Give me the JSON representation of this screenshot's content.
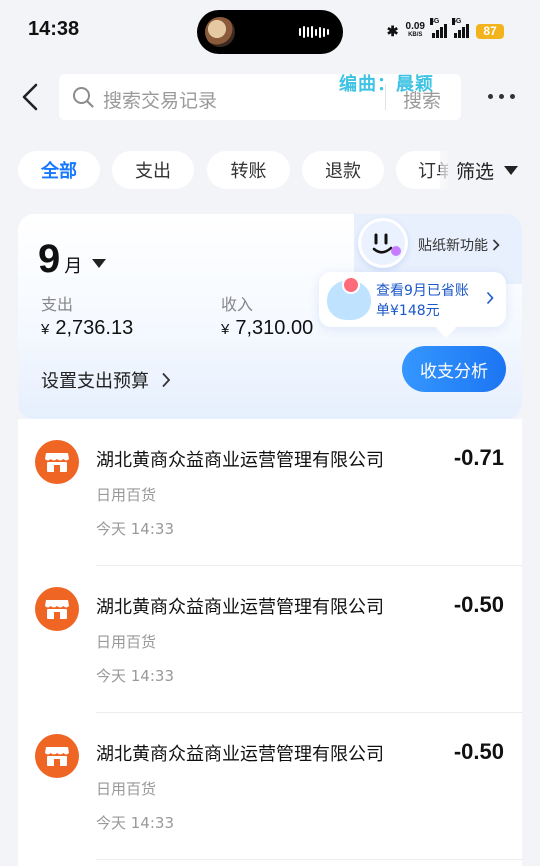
{
  "status_bar": {
    "time": "14:38",
    "net_speed": "0.09",
    "net_unit": "KB/S",
    "net_type_1": "4G",
    "net_type_2": "5G",
    "battery": "87"
  },
  "search": {
    "placeholder": "搜索交易记录",
    "button_label": "搜索",
    "icon": "search-icon"
  },
  "watermark": "编曲：晨颖",
  "filters": {
    "chips": [
      "全部",
      "支出",
      "转账",
      "退款",
      "订单"
    ],
    "active": "全部",
    "filter_label": "筛选"
  },
  "summary": {
    "sticker_link": "贴纸新功能",
    "month_num": "9",
    "month_unit": "月",
    "expense_label": "支出",
    "expense_currency": "¥",
    "expense_value": "2,736.13",
    "income_label": "收入",
    "income_currency": "¥",
    "income_value": "7,310.00",
    "budget_link": "设置支出预算",
    "save_tip_line1": "查看9月已省账",
    "save_tip_line2": "单¥148元",
    "analysis_button": "收支分析"
  },
  "transactions": [
    {
      "merchant": "湖北黄商众益商业运营管理有限公司",
      "amount": "-0.71",
      "category": "日用百货",
      "time": "今天 14:33",
      "icon": "store-icon"
    },
    {
      "merchant": "湖北黄商众益商业运营管理有限公司",
      "amount": "-0.50",
      "category": "日用百货",
      "time": "今天 14:33",
      "icon": "store-icon"
    },
    {
      "merchant": "湖北黄商众益商业运营管理有限公司",
      "amount": "-0.50",
      "category": "日用百货",
      "time": "今天 14:33",
      "icon": "store-icon"
    }
  ],
  "colors": {
    "accent": "#1677ff",
    "store_icon": "#ef6524",
    "watermark": "#3fc3e4",
    "battery": "#f3b31c"
  }
}
